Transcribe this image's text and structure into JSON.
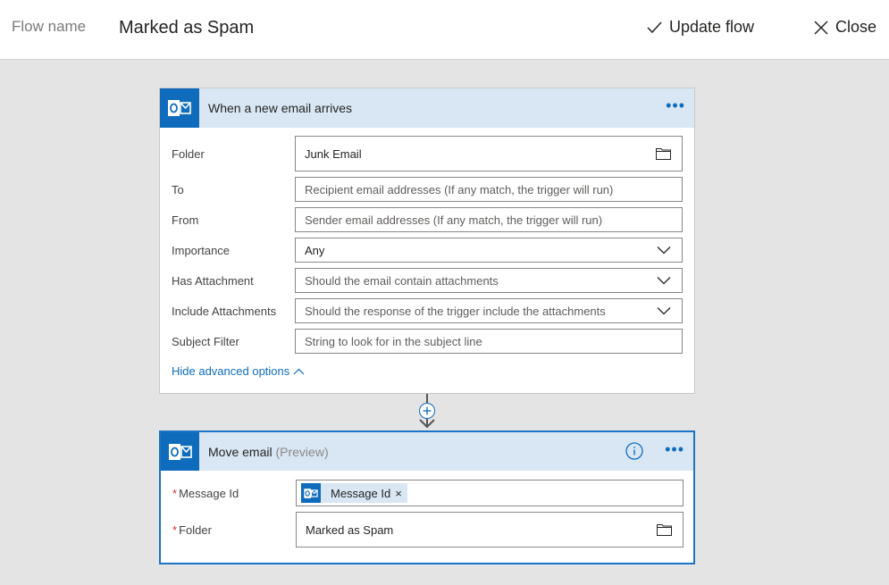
{
  "header": {
    "flow_name_label": "Flow name",
    "flow_name": "Marked as Spam",
    "update_label": "Update flow",
    "close_label": "Close"
  },
  "trigger": {
    "title": "When a new email arrives",
    "fields": {
      "folder": {
        "label": "Folder",
        "value": "Junk Email"
      },
      "to": {
        "label": "To",
        "placeholder": "Recipient email addresses (If any match, the trigger will run)"
      },
      "from": {
        "label": "From",
        "placeholder": "Sender email addresses (If any match, the trigger will run)"
      },
      "importance": {
        "label": "Importance",
        "value": "Any"
      },
      "has_attachment": {
        "label": "Has Attachment",
        "placeholder": "Should the email contain attachments"
      },
      "include_attachments": {
        "label": "Include Attachments",
        "placeholder": "Should the response of the trigger include the attachments"
      },
      "subject_filter": {
        "label": "Subject Filter",
        "placeholder": "String to look for in the subject line"
      }
    },
    "advanced_link": "Hide advanced options"
  },
  "action": {
    "title": "Move email",
    "tag": "(Preview)",
    "required_mark": "*",
    "message_id": {
      "label": "Message Id",
      "token": "Message Id",
      "token_remove": "×"
    },
    "folder": {
      "label": "Folder",
      "value": "Marked as Spam"
    }
  },
  "icons": {
    "brand": "outlook-icon",
    "folder": "folder-icon",
    "chevron": "chevron-down-icon",
    "info": "info-icon",
    "more": "more-dots-icon",
    "add": "plus-icon"
  },
  "colors": {
    "accent": "#0f6cbd",
    "card_header": "#d9e7f4",
    "required": "#d13438",
    "canvas": "#e4e4e4"
  }
}
